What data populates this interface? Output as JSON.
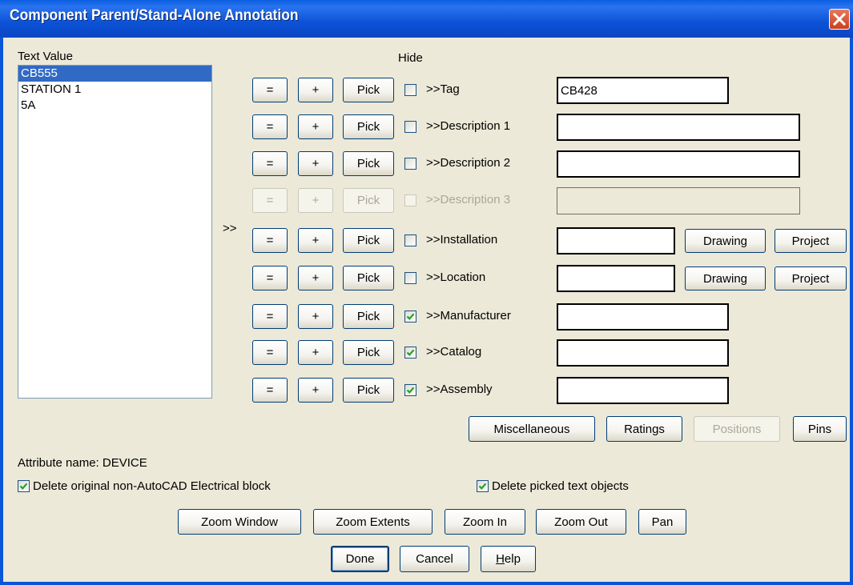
{
  "window": {
    "title": "Component Parent/Stand-Alone Annotation"
  },
  "text_value": {
    "label": "Text Value",
    "items": [
      "CB555",
      "STATION 1",
      "5A"
    ],
    "selected_index": 0
  },
  "transfer_arrow": ">>",
  "hide_label": "Hide",
  "row_buttons": {
    "equals": "=",
    "plus": "+",
    "pick": "Pick"
  },
  "fields": [
    {
      "label": ">>Tag",
      "value": "CB428",
      "hide": false,
      "enabled": true
    },
    {
      "label": ">>Description 1",
      "value": "",
      "hide": false,
      "enabled": true
    },
    {
      "label": ">>Description 2",
      "value": "",
      "hide": false,
      "enabled": true
    },
    {
      "label": ">>Description 3",
      "value": "",
      "hide": false,
      "enabled": false
    },
    {
      "label": ">>Installation",
      "value": "",
      "hide": false,
      "enabled": true
    },
    {
      "label": ">>Location",
      "value": "",
      "hide": false,
      "enabled": true
    },
    {
      "label": ">>Manufacturer",
      "value": "",
      "hide": true,
      "enabled": true
    },
    {
      "label": ">>Catalog",
      "value": "",
      "hide": true,
      "enabled": true
    },
    {
      "label": ">>Assembly",
      "value": "",
      "hide": true,
      "enabled": true
    }
  ],
  "side_buttons": {
    "drawing": "Drawing",
    "project": "Project"
  },
  "bottom_buttons": {
    "miscellaneous": "Miscellaneous",
    "ratings": "Ratings",
    "positions": "Positions",
    "pins": "Pins"
  },
  "attribute_name": "Attribute name: DEVICE",
  "options": {
    "delete_original": {
      "label": "Delete original non-AutoCAD Electrical block",
      "checked": true
    },
    "delete_picked": {
      "label": "Delete picked text objects",
      "checked": true
    }
  },
  "zoom": {
    "window": "Zoom Window",
    "extents": "Zoom Extents",
    "in": "Zoom In",
    "out": "Zoom Out",
    "pan": "Pan"
  },
  "actions": {
    "done": "Done",
    "cancel": "Cancel",
    "help_mnemonic": "H",
    "help_rest": "elp"
  },
  "colors": {
    "titlebar": "#0a5fe0",
    "dialog_bg": "#ece9d8",
    "selection": "#316ac5",
    "check": "#21a121",
    "close": "#d4502e"
  }
}
